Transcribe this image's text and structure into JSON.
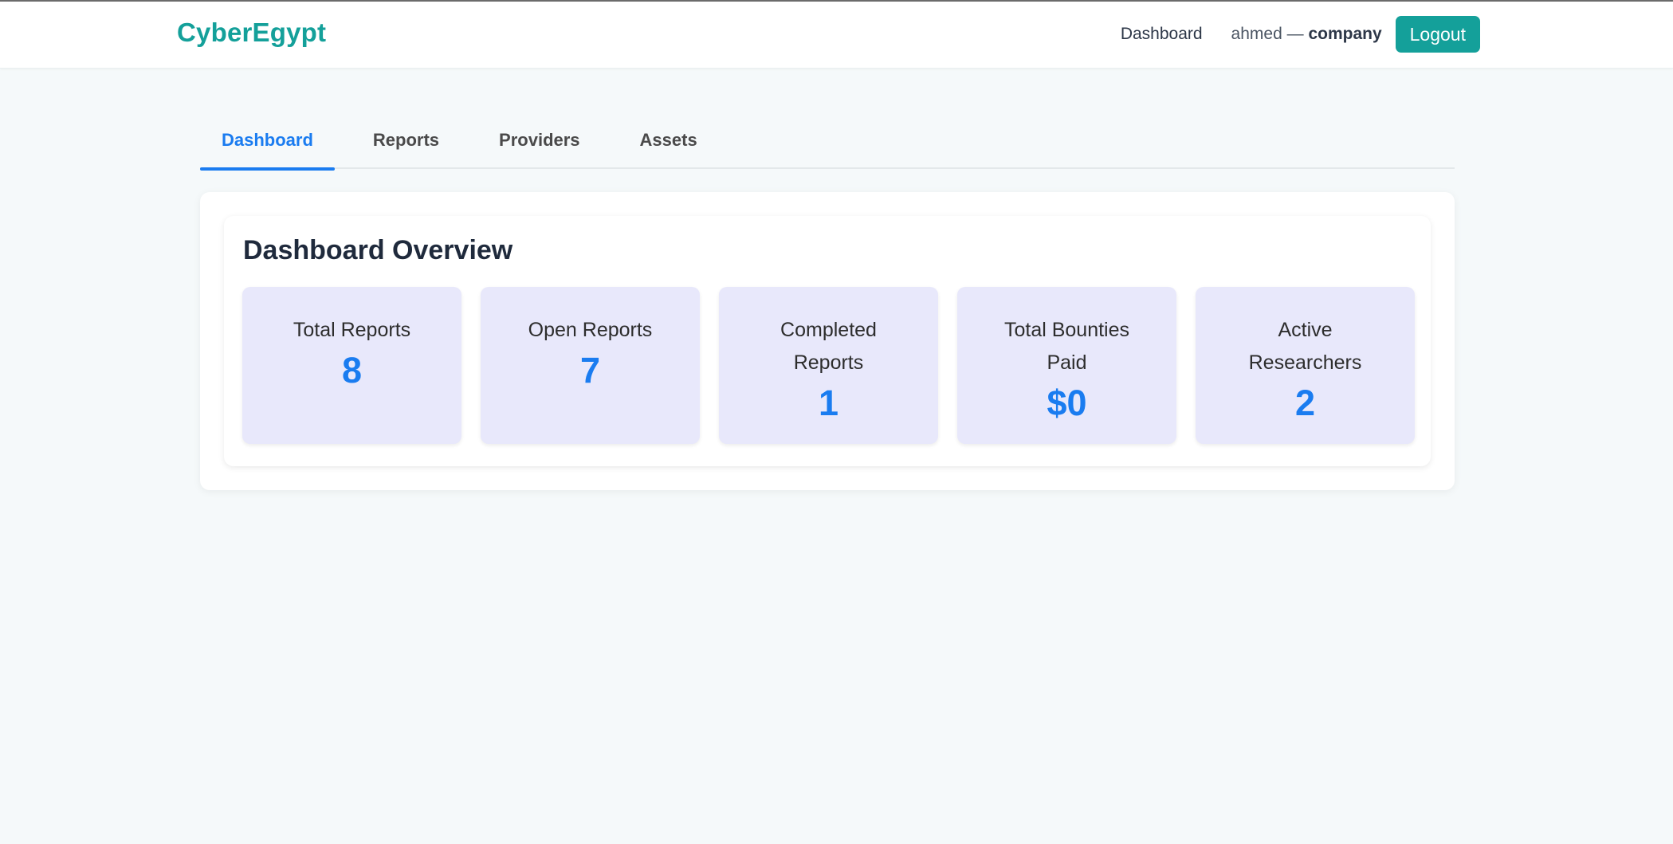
{
  "header": {
    "brand": "CyberEgypt",
    "nav_dashboard": "Dashboard",
    "user_name": "ahmed",
    "user_separator": " — ",
    "user_role": "company",
    "logout_label": "Logout"
  },
  "tabs": [
    {
      "label": "Dashboard",
      "active": true
    },
    {
      "label": "Reports",
      "active": false
    },
    {
      "label": "Providers",
      "active": false
    },
    {
      "label": "Assets",
      "active": false
    }
  ],
  "overview": {
    "title": "Dashboard Overview",
    "stats": [
      {
        "label": "Total Reports",
        "value": "8"
      },
      {
        "label": "Open Reports",
        "value": "7"
      },
      {
        "label": "Completed Reports",
        "value": "1"
      },
      {
        "label": "Total Bounties Paid",
        "value": "$0"
      },
      {
        "label": "Active Researchers",
        "value": "2"
      }
    ]
  },
  "colors": {
    "brand": "#14a09a",
    "accent": "#1a7cf0",
    "stat_card_bg": "#e8e8fb",
    "page_bg": "#f5f9fa"
  }
}
